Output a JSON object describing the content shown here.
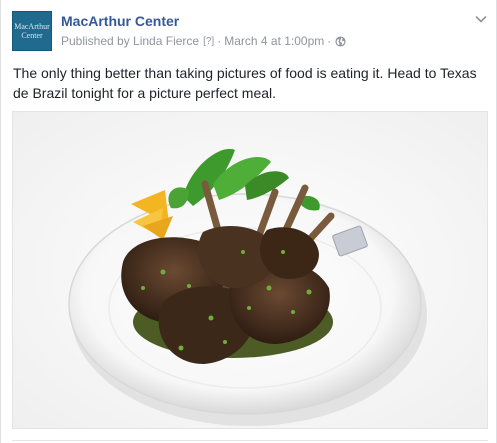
{
  "post": {
    "page_name": "MacArthur Center",
    "avatar_text_line1": "MacArthur",
    "avatar_text_line2": "Center",
    "published_by": "Published by Linda Fierce",
    "help_marker": "[?]",
    "separator": "·",
    "timestamp": "March 4 at 1:00pm",
    "privacy_icon": "globe-icon",
    "menu_icon": "chevron-down-icon",
    "message": "The only thing better than taking pictures of food is eating it. Head to Texas de Brazil tonight for a picture perfect meal.",
    "photo_subject": "lamb-chops-photo"
  },
  "colors": {
    "link": "#365899",
    "meta": "#90949c",
    "text": "#1d2129",
    "avatar_bg": "#1f6a8e"
  }
}
